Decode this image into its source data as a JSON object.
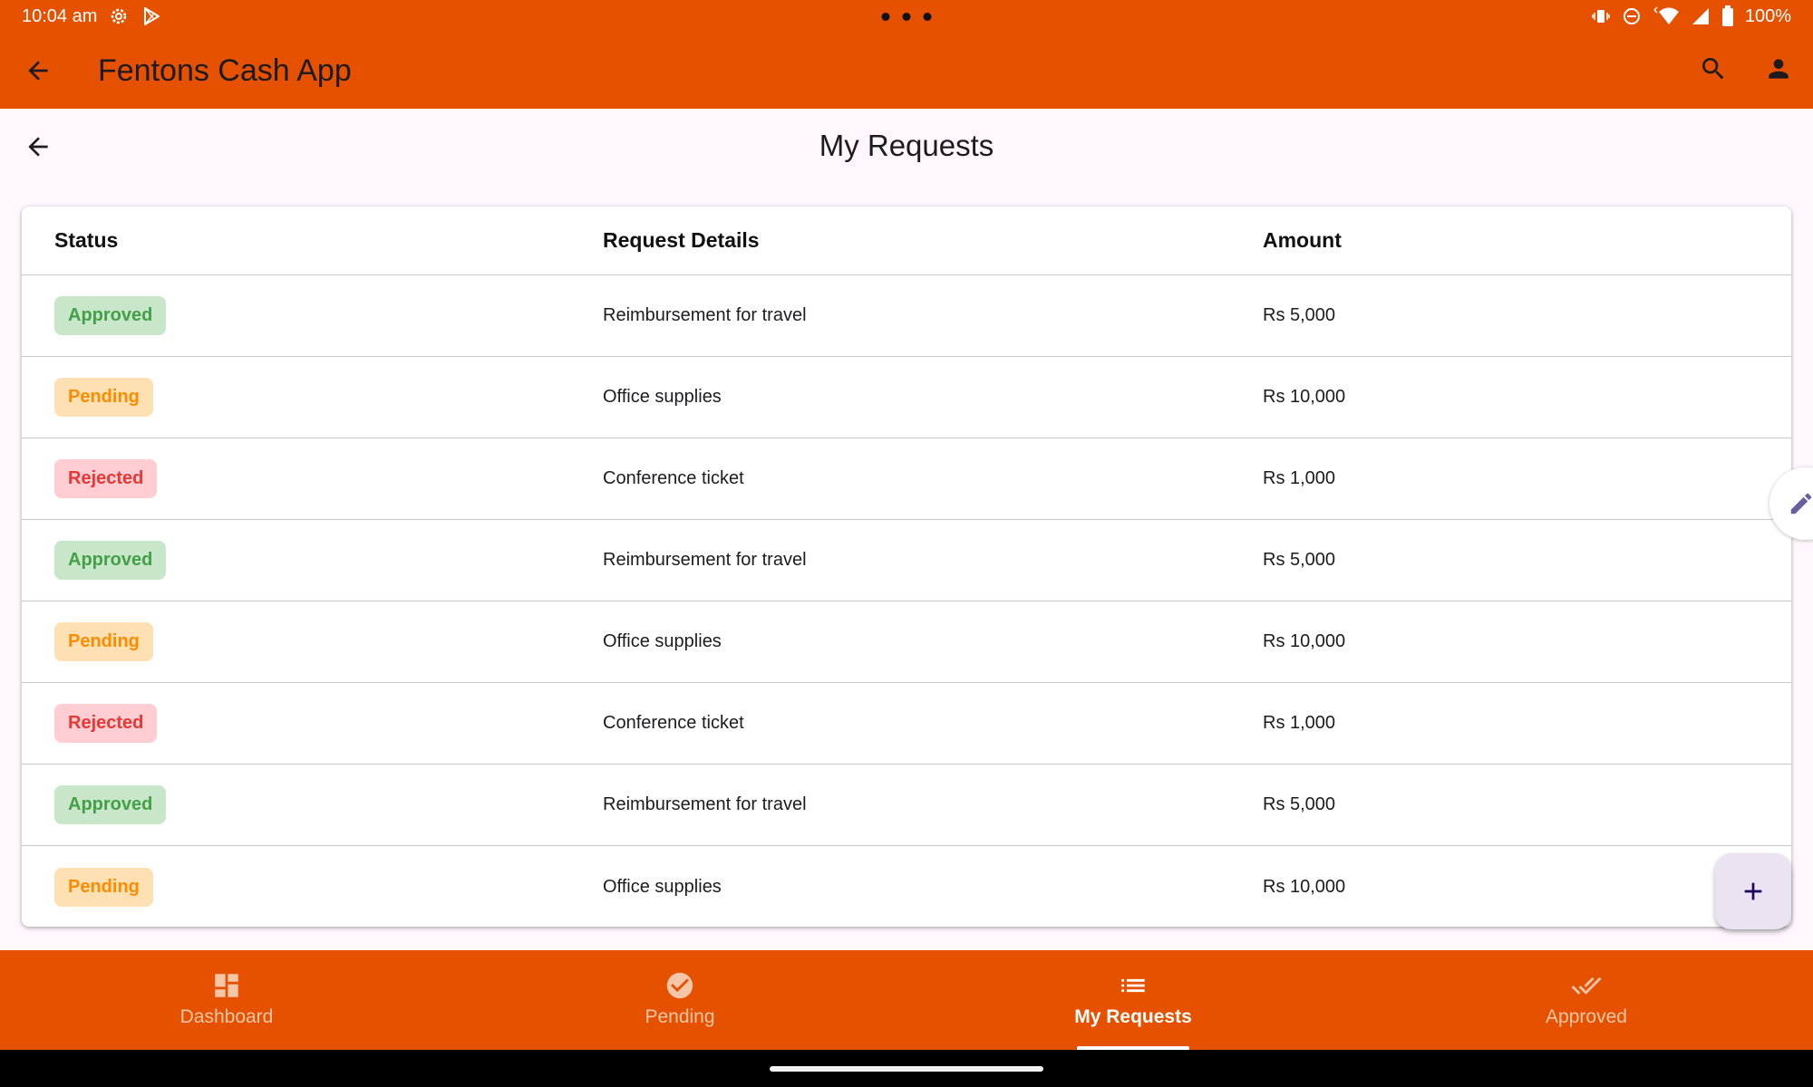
{
  "status_bar": {
    "time": "10:04 am",
    "battery": "100%"
  },
  "app_bar": {
    "title": "Fentons Cash App"
  },
  "page": {
    "title": "My Requests"
  },
  "table": {
    "headers": {
      "status": "Status",
      "details": "Request Details",
      "amount": "Amount"
    },
    "rows": [
      {
        "status": "Approved",
        "details": "Reimbursement for travel",
        "amount": "Rs 5,000"
      },
      {
        "status": "Pending",
        "details": "Office supplies",
        "amount": "Rs 10,000"
      },
      {
        "status": "Rejected",
        "details": "Conference ticket",
        "amount": "Rs 1,000"
      },
      {
        "status": "Approved",
        "details": "Reimbursement for travel",
        "amount": "Rs 5,000"
      },
      {
        "status": "Pending",
        "details": "Office supplies",
        "amount": "Rs 10,000"
      },
      {
        "status": "Rejected",
        "details": "Conference ticket",
        "amount": "Rs 1,000"
      },
      {
        "status": "Approved",
        "details": "Reimbursement for travel",
        "amount": "Rs 5,000"
      },
      {
        "status": "Pending",
        "details": "Office supplies",
        "amount": "Rs 10,000"
      }
    ]
  },
  "bottom_nav": {
    "items": [
      {
        "label": "Dashboard",
        "icon": "dashboard-icon"
      },
      {
        "label": "Pending",
        "icon": "check-circle-icon"
      },
      {
        "label": "My Requests",
        "icon": "list-icon"
      },
      {
        "label": "Approved",
        "icon": "done-all-icon"
      }
    ],
    "active": "My Requests"
  },
  "colors": {
    "brand": "#e65100",
    "approved_bg": "#c8e6c9",
    "approved_text": "#43a047",
    "pending_bg": "#ffe0b2",
    "pending_text": "#fb8c00",
    "rejected_bg": "#ffcdd2",
    "rejected_text": "#e53935"
  }
}
